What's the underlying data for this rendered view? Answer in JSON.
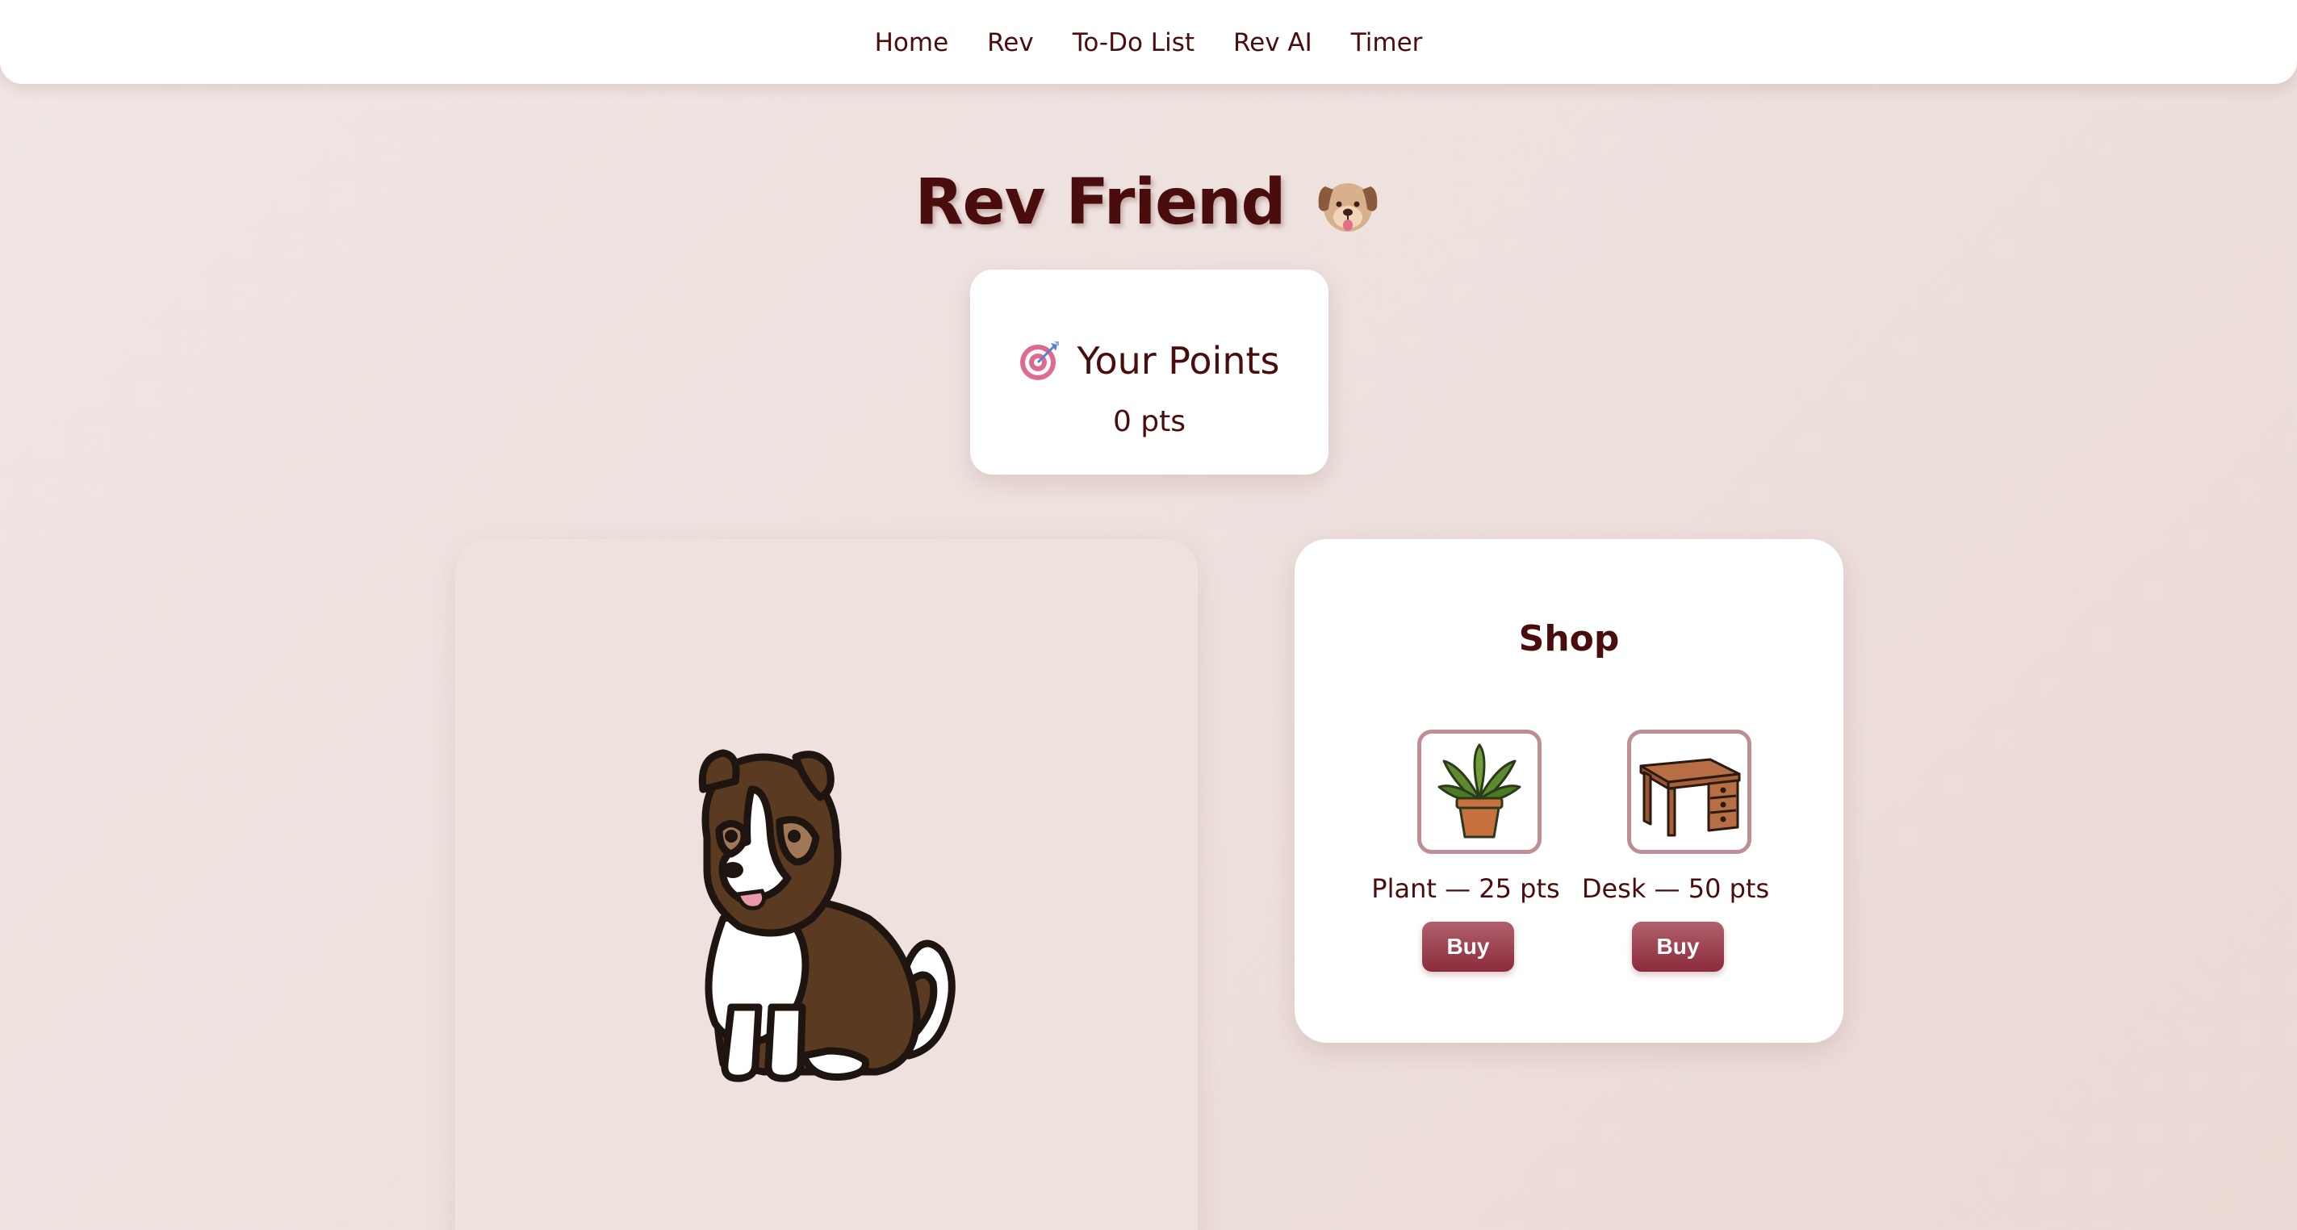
{
  "nav": {
    "links": [
      "Home",
      "Rev",
      "To-Do List",
      "Rev AI",
      "Timer"
    ]
  },
  "page": {
    "title": "Rev Friend",
    "title_icon": "dog-face-emoji"
  },
  "points": {
    "icon": "target-icon",
    "heading": "Your Points",
    "value": "0 pts"
  },
  "pet": {
    "illustration": "dog-illustration"
  },
  "shop": {
    "title": "Shop",
    "items": [
      {
        "icon": "plant-icon",
        "label": "Plant — 25 pts",
        "button": "Buy"
      },
      {
        "icon": "desk-icon",
        "label": "Desk — 50 pts",
        "button": "Buy"
      }
    ]
  },
  "colors": {
    "text": "#4a0d0d",
    "button": "#8c2b3c",
    "frame_border": "#c08d94",
    "background": "#efe3e0"
  }
}
